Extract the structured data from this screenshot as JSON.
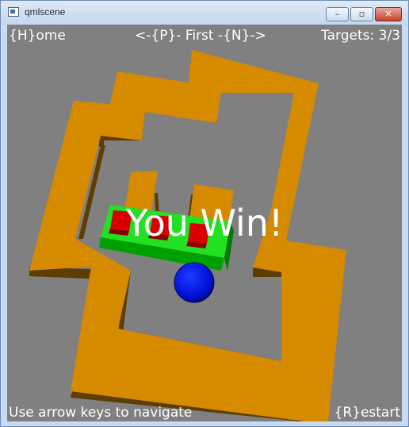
{
  "window": {
    "title": "qmlscene",
    "app_icon": "window-icon",
    "controls": {
      "minimize": "–",
      "maximize": "▫",
      "close": "✕"
    }
  },
  "hud": {
    "home": "{H}ome",
    "nav": "<-{P}-  First  -{N}->",
    "targets": "Targets: 3/3",
    "help": "Use arrow keys to navigate",
    "restart": "{R}estart"
  },
  "status": {
    "message": "You Win!"
  },
  "colors": {
    "background": "#808080",
    "wall_top": "#d58a00",
    "wall_side": "#5e3d00",
    "platform": "#00c800",
    "target_box": "#cc0000",
    "ball": "#0010d8",
    "text": "#ffffff"
  }
}
